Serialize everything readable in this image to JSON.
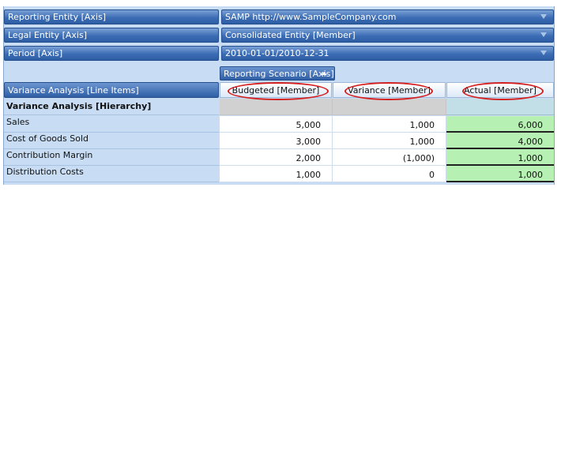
{
  "filters": [
    {
      "label": "Reporting Entity [Axis]",
      "value": "SAMP http://www.SampleCompany.com"
    },
    {
      "label": "Legal Entity [Axis]",
      "value": "Consolidated Entity [Member]"
    },
    {
      "label": "Period [Axis]",
      "value": "2010-01-01/2010-12-31"
    }
  ],
  "scenario_axis": {
    "label": "Reporting Scenario [Axis]"
  },
  "line_items": {
    "label": "Variance Analysis [Line Items]"
  },
  "columns": [
    "Budgeted [Member]",
    "Variance [Member]",
    "Actual [Member]"
  ],
  "hierarchy": {
    "label": "Variance Analysis [Hierarchy]"
  },
  "rows": [
    {
      "label": "Sales",
      "budgeted": "5,000",
      "variance": "1,000",
      "actual": "6,000"
    },
    {
      "label": "Cost of Goods Sold",
      "budgeted": "3,000",
      "variance": "1,000",
      "actual": "4,000"
    },
    {
      "label": "Contribution Margin",
      "budgeted": "2,000",
      "variance": "(1,000)",
      "actual": "1,000"
    },
    {
      "label": "Distribution Costs",
      "budgeted": "1,000",
      "variance": "0",
      "actual": "1,000"
    }
  ],
  "colors": {
    "header_blue": "#3c6db4",
    "panel_blue": "#c8ddf3",
    "actual_green": "#b7f0b3",
    "highlight_red": "#d61f1f"
  }
}
